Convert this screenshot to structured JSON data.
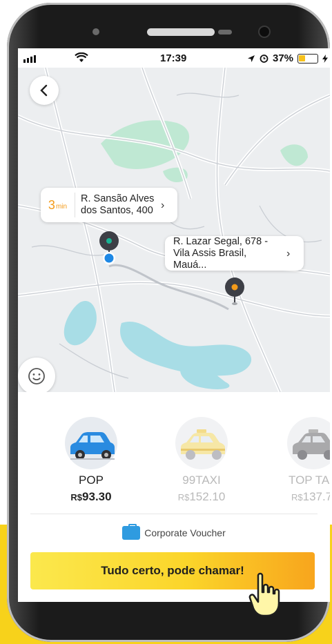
{
  "status_bar": {
    "time": "17:39",
    "battery": "37%",
    "battery_level": 0.37
  },
  "map": {
    "origin": {
      "eta_value": "3",
      "eta_unit": "min",
      "address": "R. Sansão Alves dos Santos, 400"
    },
    "destination": {
      "address": "R. Lazar Segal, 678 - Vila Assis Brasil, Mauá..."
    }
  },
  "ride_options": [
    {
      "name": "POP",
      "currency": "R$",
      "price": "93.30",
      "selected": true
    },
    {
      "name": "99TAXI",
      "currency": "R$",
      "price": "152.10",
      "selected": false
    },
    {
      "name": "TOP TA",
      "currency": "R$",
      "price": "137.7",
      "selected": false
    }
  ],
  "voucher_label": "Corporate Voucher",
  "cta_label": "Tudo certo, pode chamar!",
  "colors": {
    "accent": "#f7d21b",
    "eta": "#f39b1a",
    "route_pin": "#16a085",
    "dest_pin": "#f39b1a",
    "voucher": "#2f9be0"
  },
  "icons": [
    "back-arrow-icon",
    "smiley-icon",
    "location-arrow-icon",
    "alarm-icon",
    "wifi-icon",
    "briefcase-icon",
    "hand-cursor-icon"
  ]
}
